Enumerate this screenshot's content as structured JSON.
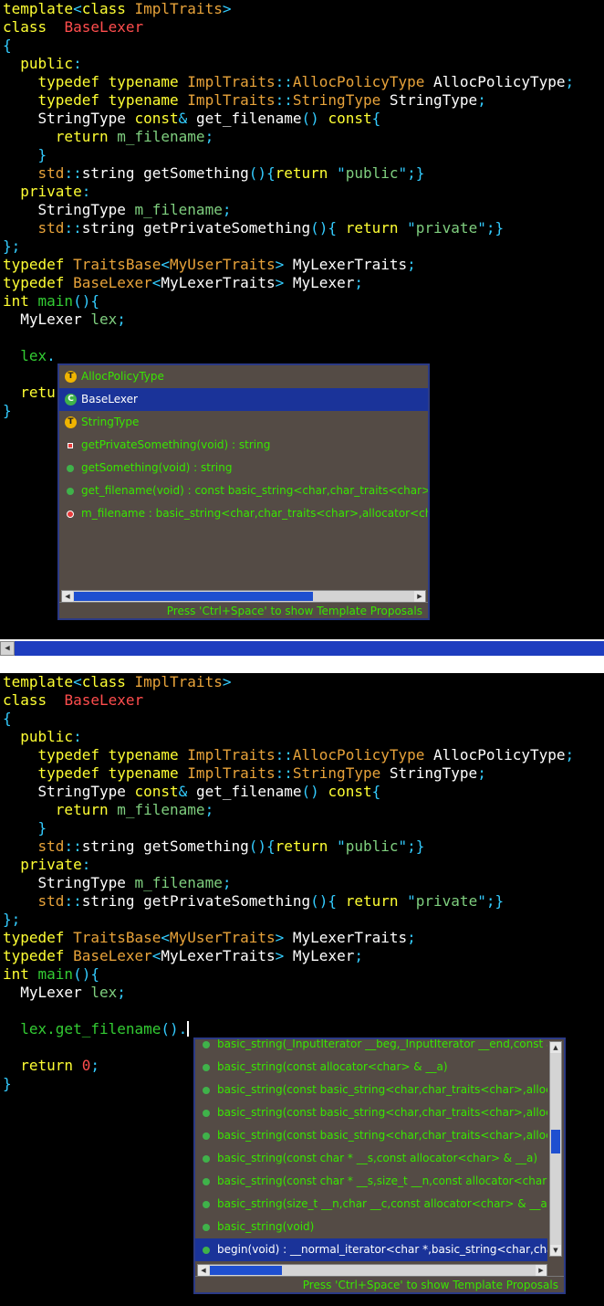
{
  "pane1": {
    "lines": [
      [
        [
          "kw",
          "template"
        ],
        [
          "pu",
          "<"
        ],
        [
          "kw",
          "class "
        ],
        [
          "ty",
          "ImplTraits"
        ],
        [
          "pu",
          ">"
        ]
      ],
      [
        [
          "kw",
          "class  "
        ],
        [
          "nm",
          "BaseLexer"
        ]
      ],
      [
        [
          "pu",
          "{"
        ]
      ],
      [
        [
          "id",
          "  "
        ],
        [
          "kw",
          "public"
        ],
        [
          "pu",
          ":"
        ]
      ],
      [
        [
          "id",
          "    "
        ],
        [
          "kw",
          "typedef typename "
        ],
        [
          "ty",
          "ImplTraits"
        ],
        [
          "pu",
          "::"
        ],
        [
          "ty",
          "AllocPolicyType"
        ],
        [
          "id",
          " AllocPolicyType"
        ],
        [
          "pu",
          ";"
        ]
      ],
      [
        [
          "id",
          "    "
        ],
        [
          "kw",
          "typedef typename "
        ],
        [
          "ty",
          "ImplTraits"
        ],
        [
          "pu",
          "::"
        ],
        [
          "ty",
          "StringType"
        ],
        [
          "id",
          " StringType"
        ],
        [
          "pu",
          ";"
        ]
      ],
      [
        [
          "id",
          "    StringType "
        ],
        [
          "kw",
          "const"
        ],
        [
          "pu",
          "& "
        ],
        [
          "id",
          "get_filename"
        ],
        [
          "pu",
          "() "
        ],
        [
          "kw",
          "const"
        ],
        [
          "pu",
          "{"
        ]
      ],
      [
        [
          "id",
          "      "
        ],
        [
          "kw",
          "return "
        ],
        [
          "ps",
          "m_filename"
        ],
        [
          "pu",
          ";"
        ]
      ],
      [
        [
          "id",
          "    "
        ],
        [
          "pu",
          "}"
        ]
      ],
      [
        [
          "id",
          "    "
        ],
        [
          "ty",
          "std"
        ],
        [
          "pu",
          "::"
        ],
        [
          "id",
          "string getSomething"
        ],
        [
          "pu",
          "(){"
        ],
        [
          "kw",
          "return "
        ],
        [
          "pu",
          "\""
        ],
        [
          "ps",
          "public"
        ],
        [
          "pu",
          "\";}"
        ]
      ],
      [
        [
          "id",
          "  "
        ],
        [
          "kw",
          "private"
        ],
        [
          "pu",
          ":"
        ]
      ],
      [
        [
          "id",
          "    StringType "
        ],
        [
          "ps",
          "m_filename"
        ],
        [
          "pu",
          ";"
        ]
      ],
      [
        [
          "id",
          "    "
        ],
        [
          "ty",
          "std"
        ],
        [
          "pu",
          "::"
        ],
        [
          "id",
          "string getPrivateSomething"
        ],
        [
          "pu",
          "(){ "
        ],
        [
          "kw",
          "return "
        ],
        [
          "pu",
          "\""
        ],
        [
          "ps",
          "private"
        ],
        [
          "pu",
          "\";}"
        ]
      ],
      [
        [
          "pu",
          "};"
        ]
      ],
      [
        [
          "kw",
          "typedef "
        ],
        [
          "ty",
          "TraitsBase"
        ],
        [
          "pu",
          "<"
        ],
        [
          "ty",
          "MyUserTraits"
        ],
        [
          "pu",
          "> "
        ],
        [
          "id",
          "MyLexerTraits"
        ],
        [
          "pu",
          ";"
        ]
      ],
      [
        [
          "kw",
          "typedef "
        ],
        [
          "ty",
          "BaseLexer"
        ],
        [
          "pu",
          "<"
        ],
        [
          "id",
          "MyLexerTraits"
        ],
        [
          "pu",
          "> "
        ],
        [
          "id",
          "MyLexer"
        ],
        [
          "pu",
          ";"
        ]
      ],
      [
        [
          "kw",
          "int "
        ],
        [
          "ln",
          "main"
        ],
        [
          "pu",
          "(){"
        ]
      ],
      [
        [
          "id",
          "  MyLexer "
        ],
        [
          "ps",
          "lex"
        ],
        [
          "pu",
          ";"
        ]
      ],
      [
        [
          "id",
          " "
        ]
      ],
      [
        [
          "id",
          "  "
        ],
        [
          "ln",
          "lex"
        ],
        [
          "pu",
          "."
        ]
      ],
      [
        [
          "id",
          " "
        ]
      ],
      [
        [
          "id",
          "  "
        ],
        [
          "kw",
          "retu"
        ]
      ],
      [
        [
          "pu",
          "}"
        ]
      ]
    ]
  },
  "pane2": {
    "lines": [
      [
        [
          "kw",
          "template"
        ],
        [
          "pu",
          "<"
        ],
        [
          "kw",
          "class "
        ],
        [
          "ty",
          "ImplTraits"
        ],
        [
          "pu",
          ">"
        ]
      ],
      [
        [
          "kw",
          "class  "
        ],
        [
          "nm",
          "BaseLexer"
        ]
      ],
      [
        [
          "pu",
          "{"
        ]
      ],
      [
        [
          "id",
          "  "
        ],
        [
          "kw",
          "public"
        ],
        [
          "pu",
          ":"
        ]
      ],
      [
        [
          "id",
          "    "
        ],
        [
          "kw",
          "typedef typename "
        ],
        [
          "ty",
          "ImplTraits"
        ],
        [
          "pu",
          "::"
        ],
        [
          "ty",
          "AllocPolicyType"
        ],
        [
          "id",
          " AllocPolicyType"
        ],
        [
          "pu",
          ";"
        ]
      ],
      [
        [
          "id",
          "    "
        ],
        [
          "kw",
          "typedef typename "
        ],
        [
          "ty",
          "ImplTraits"
        ],
        [
          "pu",
          "::"
        ],
        [
          "ty",
          "StringType"
        ],
        [
          "id",
          " StringType"
        ],
        [
          "pu",
          ";"
        ]
      ],
      [
        [
          "id",
          "    StringType "
        ],
        [
          "kw",
          "const"
        ],
        [
          "pu",
          "& "
        ],
        [
          "id",
          "get_filename"
        ],
        [
          "pu",
          "() "
        ],
        [
          "kw",
          "const"
        ],
        [
          "pu",
          "{"
        ]
      ],
      [
        [
          "id",
          "      "
        ],
        [
          "kw",
          "return "
        ],
        [
          "ps",
          "m_filename"
        ],
        [
          "pu",
          ";"
        ]
      ],
      [
        [
          "id",
          "    "
        ],
        [
          "pu",
          "}"
        ]
      ],
      [
        [
          "id",
          "    "
        ],
        [
          "ty",
          "std"
        ],
        [
          "pu",
          "::"
        ],
        [
          "id",
          "string getSomething"
        ],
        [
          "pu",
          "(){"
        ],
        [
          "kw",
          "return "
        ],
        [
          "pu",
          "\""
        ],
        [
          "ps",
          "public"
        ],
        [
          "pu",
          "\";}"
        ]
      ],
      [
        [
          "id",
          "  "
        ],
        [
          "kw",
          "private"
        ],
        [
          "pu",
          ":"
        ]
      ],
      [
        [
          "id",
          "    StringType "
        ],
        [
          "ps",
          "m_filename"
        ],
        [
          "pu",
          ";"
        ]
      ],
      [
        [
          "id",
          "    "
        ],
        [
          "ty",
          "std"
        ],
        [
          "pu",
          "::"
        ],
        [
          "id",
          "string getPrivateSomething"
        ],
        [
          "pu",
          "(){ "
        ],
        [
          "kw",
          "return "
        ],
        [
          "pu",
          "\""
        ],
        [
          "ps",
          "private"
        ],
        [
          "pu",
          "\";}"
        ]
      ],
      [
        [
          "pu",
          "};"
        ]
      ],
      [
        [
          "kw",
          "typedef "
        ],
        [
          "ty",
          "TraitsBase"
        ],
        [
          "pu",
          "<"
        ],
        [
          "ty",
          "MyUserTraits"
        ],
        [
          "pu",
          "> "
        ],
        [
          "id",
          "MyLexerTraits"
        ],
        [
          "pu",
          ";"
        ]
      ],
      [
        [
          "kw",
          "typedef "
        ],
        [
          "ty",
          "BaseLexer"
        ],
        [
          "pu",
          "<"
        ],
        [
          "id",
          "MyLexerTraits"
        ],
        [
          "pu",
          "> "
        ],
        [
          "id",
          "MyLexer"
        ],
        [
          "pu",
          ";"
        ]
      ],
      [
        [
          "kw",
          "int "
        ],
        [
          "ln",
          "main"
        ],
        [
          "pu",
          "(){"
        ]
      ],
      [
        [
          "id",
          "  MyLexer "
        ],
        [
          "ps",
          "lex"
        ],
        [
          "pu",
          ";"
        ]
      ],
      [
        [
          "id",
          " "
        ]
      ],
      [
        [
          "id",
          "  "
        ],
        [
          "ln",
          "lex.get_filename"
        ],
        [
          "pu",
          "()."
        ]
      ],
      [
        [
          "id",
          " "
        ]
      ],
      [
        [
          "id",
          "  "
        ],
        [
          "kw",
          "return "
        ],
        [
          "nm",
          "0"
        ],
        [
          "pu",
          ";"
        ]
      ],
      [
        [
          "pu",
          "}"
        ]
      ]
    ]
  },
  "popup1": {
    "items": [
      {
        "icon": "type-icon",
        "label": "AllocPolicyType",
        "selected": false
      },
      {
        "icon": "class-icon",
        "label": "BaseLexer",
        "selected": true
      },
      {
        "icon": "type-icon",
        "label": "StringType",
        "selected": false
      },
      {
        "icon": "private-method-icon",
        "label": "getPrivateSomething(void) : string",
        "selected": false
      },
      {
        "icon": "public-method-icon",
        "label": "getSomething(void) : string",
        "selected": false
      },
      {
        "icon": "public-method-icon",
        "label": "get_filename(void) : const basic_string<char,char_traits<char>,allocator<char>> &",
        "selected": false
      },
      {
        "icon": "private-field-icon",
        "label": "m_filename : basic_string<char,char_traits<char>,allocator<char>>",
        "selected": false
      }
    ],
    "hint": "Press 'Ctrl+Space' to show Template Proposals",
    "hscroll_fraction": 0.7
  },
  "popup2": {
    "items": [
      {
        "icon": "public-method-icon",
        "label": "basic_string(_InputIterator __beg,_InputIterator __end,const allocator<char> & __a)",
        "selected": false
      },
      {
        "icon": "public-method-icon",
        "label": "basic_string(const allocator<char> & __a)",
        "selected": false
      },
      {
        "icon": "public-method-icon",
        "label": "basic_string(const basic_string<char,char_traits<char>,allocator<char>> & __str)",
        "selected": false
      },
      {
        "icon": "public-method-icon",
        "label": "basic_string(const basic_string<char,char_traits<char>,allocator<char>> & __str,size_t __pos)",
        "selected": false
      },
      {
        "icon": "public-method-icon",
        "label": "basic_string(const basic_string<char,char_traits<char>,allocator<char>> & __str,size_t __pos,size_t __n)",
        "selected": false
      },
      {
        "icon": "public-method-icon",
        "label": "basic_string(const char * __s,const allocator<char> & __a)",
        "selected": false
      },
      {
        "icon": "public-method-icon",
        "label": "basic_string(const char * __s,size_t __n,const allocator<char> & __a)",
        "selected": false
      },
      {
        "icon": "public-method-icon",
        "label": "basic_string(size_t __n,char __c,const allocator<char> & __a)",
        "selected": false
      },
      {
        "icon": "public-method-icon",
        "label": "basic_string(void)",
        "selected": false
      },
      {
        "icon": "public-method-icon",
        "label": "begin(void) : __normal_iterator<char *,basic_string<char,char_traits<char>,allocator<char>>>",
        "selected": true
      }
    ],
    "hint": "Press 'Ctrl+Space' to show Template Proposals",
    "hscroll_fraction": 0.22,
    "vscroll_fraction": 0.45
  }
}
